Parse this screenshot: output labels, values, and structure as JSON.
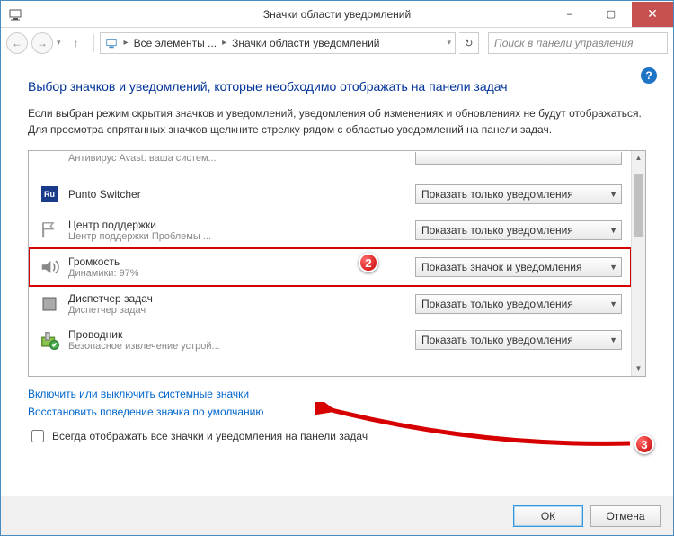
{
  "window": {
    "title": "Значки области уведомлений",
    "minimize": "–",
    "maximize": "▢",
    "close": "✕"
  },
  "nav": {
    "back": "←",
    "forward": "→",
    "up": "↑",
    "breadcrumb_root": "Все элементы ...",
    "breadcrumb_current": "Значки области уведомлений",
    "refresh": "↻",
    "search_placeholder": "Поиск в панели управления"
  },
  "help": "?",
  "heading": "Выбор значков и уведомлений, которые необходимо отображать на панели задач",
  "description": "Если выбран режим скрытия значков и уведомлений, уведомления об изменениях и обновлениях не будут отображаться. Для просмотра спрятанных значков щелкните стрелку рядом с областью уведомлений на панели задач.",
  "options": {
    "show_notifications_only": "Показать только уведомления",
    "show_icon_and_notifications": "Показать значок и уведомления"
  },
  "items": [
    {
      "name": "",
      "sub": "Антивирус Avast: ваша систем...",
      "value": "show_notifications_only",
      "icon": "partial-top"
    },
    {
      "name": "Punto Switcher",
      "sub": "",
      "value": "show_notifications_only",
      "icon": "ru"
    },
    {
      "name": "Центр поддержки",
      "sub": "Центр поддержки   Проблемы ...",
      "value": "show_notifications_only",
      "icon": "flag"
    },
    {
      "name": "Громкость",
      "sub": "Динамики: 97%",
      "value": "show_icon_and_notifications",
      "icon": "volume",
      "highlight": true
    },
    {
      "name": "Диспетчер задач",
      "sub": "Диспетчер задач",
      "value": "show_notifications_only",
      "icon": "task"
    },
    {
      "name": "Проводник",
      "sub": "Безопасное извлечение устрой...",
      "value": "show_notifications_only",
      "icon": "explorer"
    }
  ],
  "links": {
    "toggle_system_icons": "Включить или выключить системные значки",
    "restore_defaults": "Восстановить поведение значка по умолчанию"
  },
  "checkbox_label": "Всегда отображать все значки и уведомления на панели задач",
  "buttons": {
    "ok": "ОК",
    "cancel": "Отмена"
  },
  "annotations": {
    "badge2": "2",
    "badge3": "3"
  }
}
